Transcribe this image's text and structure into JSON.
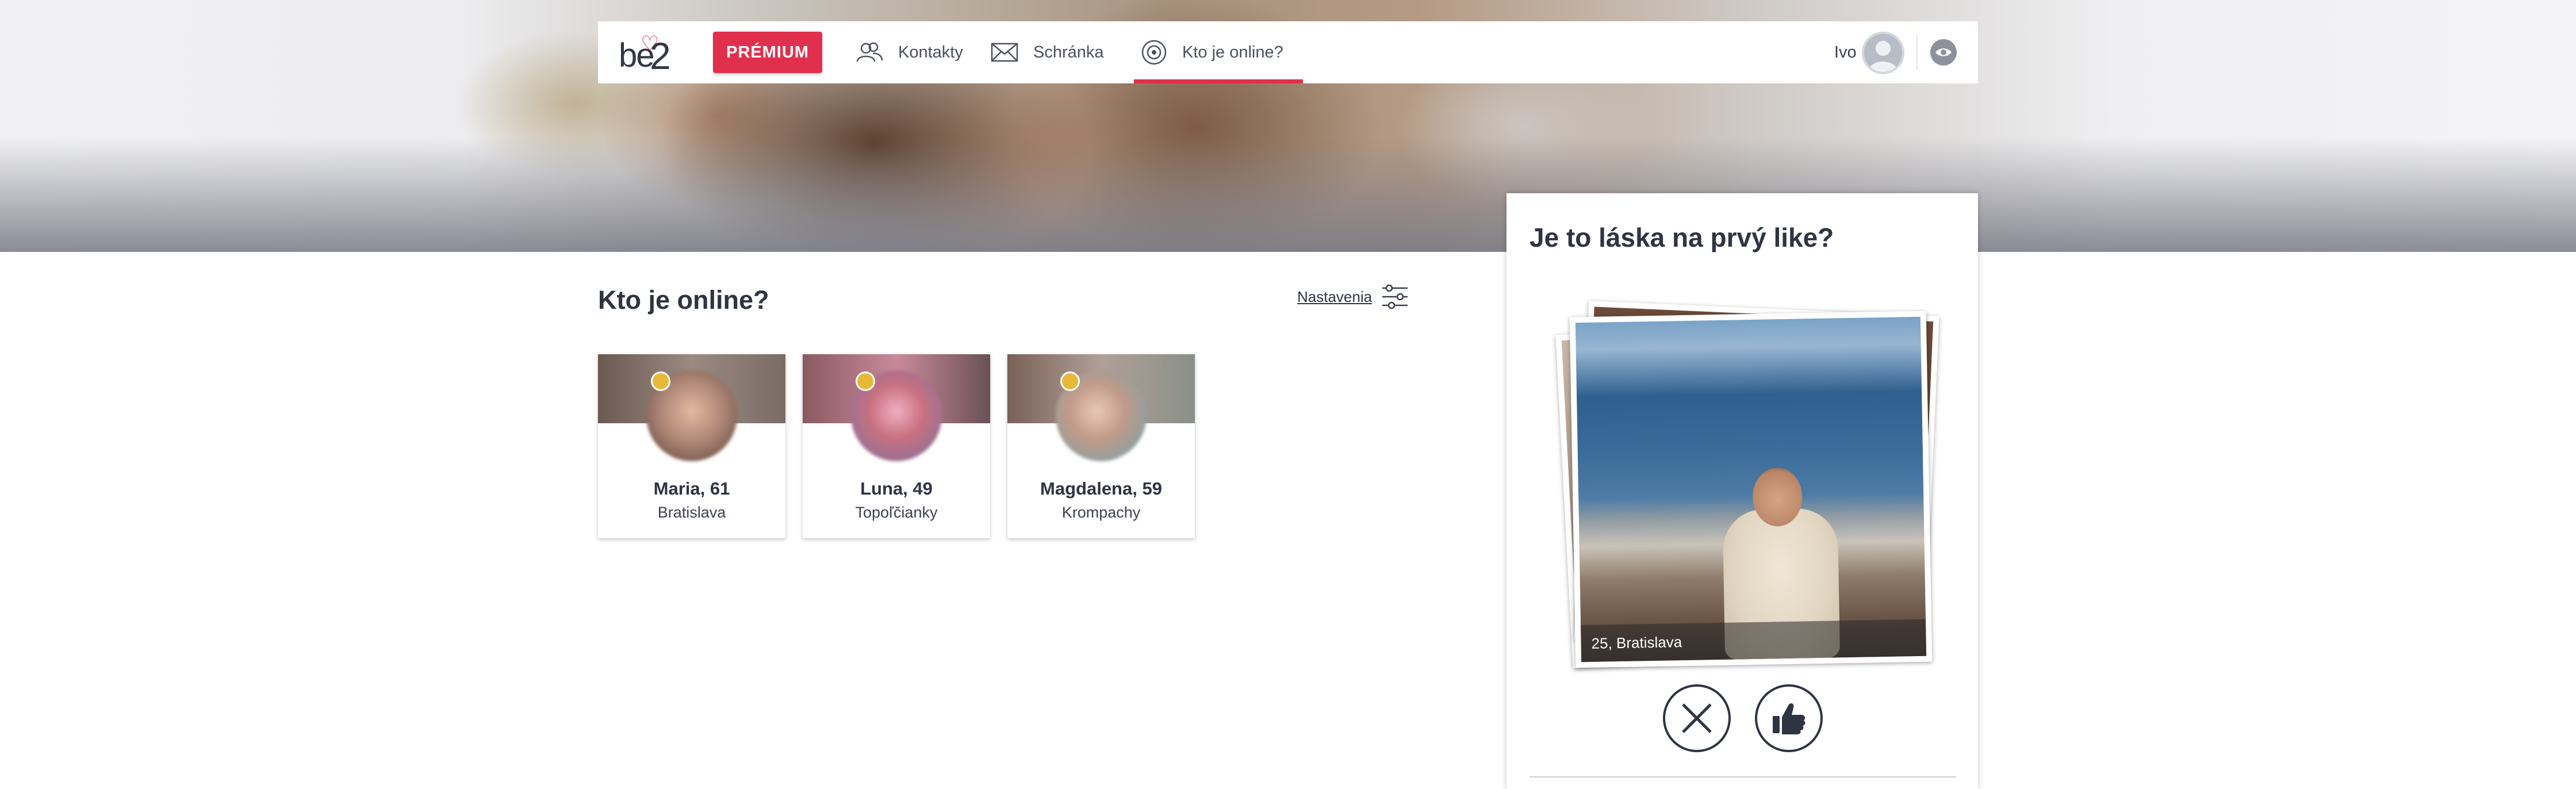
{
  "header": {
    "logo_text": "be2",
    "premium_label": "PRÉMIUM",
    "nav": [
      {
        "label": "Kontakty",
        "icon": "contacts-icon"
      },
      {
        "label": "Schránka",
        "icon": "envelope-icon"
      },
      {
        "label": "Kto je online?",
        "icon": "online-target-icon",
        "active": true
      }
    ],
    "user_name": "Ivo"
  },
  "colors": {
    "accent": "#e0304d",
    "online_dot": "#e8b839",
    "text": "#2f3442"
  },
  "online": {
    "title": "Kto je online?",
    "settings_label": "Nastavenia",
    "profiles": [
      {
        "name": "Maria, 61",
        "city": "Bratislava"
      },
      {
        "name": "Luna, 49",
        "city": "Topoľčianky"
      },
      {
        "name": "Magdalena, 59",
        "city": "Krompachy"
      }
    ]
  },
  "like_panel": {
    "title": "Je to láska na prvý like?",
    "caption": "25, Bratislava"
  }
}
